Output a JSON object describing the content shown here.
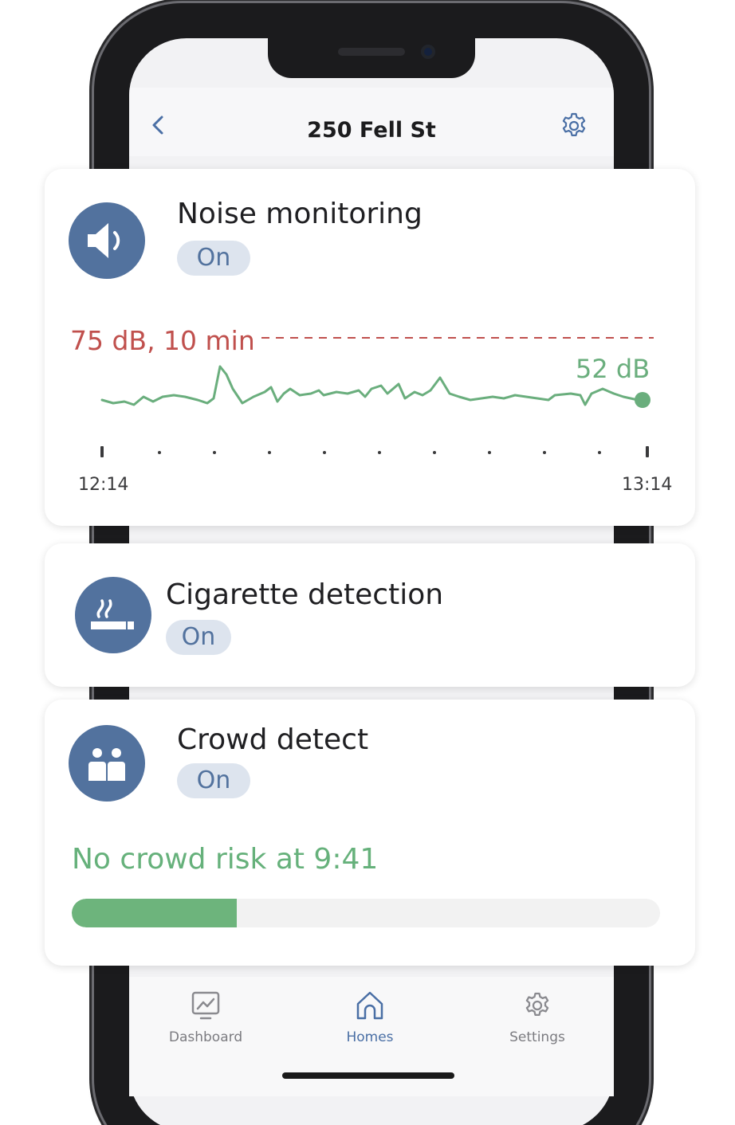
{
  "header": {
    "title": "250 Fell St"
  },
  "noise": {
    "title": "Noise monitoring",
    "status": "On",
    "threshold_label": "75 dB, 10 min",
    "current_label": "52 dB",
    "time_start": "12:14",
    "time_end": "13:14",
    "colors": {
      "line": "#6aae7d",
      "threshold": "#c0504d"
    }
  },
  "cigarette": {
    "title": "Cigarette detection",
    "status": "On"
  },
  "crowd": {
    "title": "Crowd detect",
    "status": "On",
    "status_text": "No crowd risk at 9:41",
    "risk_fraction": 0.28
  },
  "tabs": [
    {
      "label": "Dashboard",
      "icon": "dashboard-icon"
    },
    {
      "label": "Homes",
      "icon": "home-icon"
    },
    {
      "label": "Settings",
      "icon": "settings-icon"
    }
  ],
  "colors": {
    "accent": "#52729e",
    "pill_bg": "#dde4ee",
    "green": "#66b17b"
  }
}
